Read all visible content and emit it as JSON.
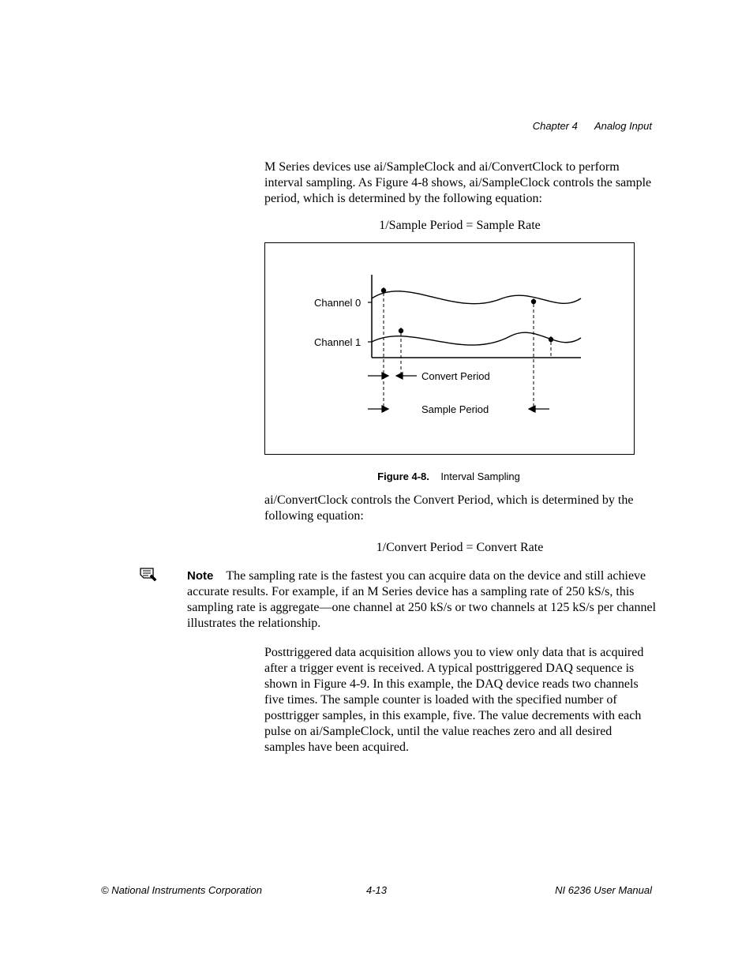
{
  "header": {
    "chapter": "Chapter 4",
    "title": "Analog Input"
  },
  "paragraphs": {
    "p1": "M Series devices use ai/SampleClock and ai/ConvertClock to perform interval sampling. As Figure 4-8 shows, ai/SampleClock controls the sample period, which is determined by the following equation:",
    "eq1": "1/Sample Period = Sample Rate",
    "p2": "ai/ConvertClock controls the Convert Period, which is determined by the following equation:",
    "eq2": "1/Convert Period = Convert Rate",
    "p3": "Posttriggered data acquisition allows you to view only data that is acquired after a trigger event is received. A typical posttriggered DAQ sequence is shown in Figure 4-9. In this example, the DAQ device reads two channels five times. The sample counter is loaded with the specified number of posttrigger samples, in this example, five. The value decrements with each pulse on ai/SampleClock, until the value reaches zero and all desired samples have been acquired."
  },
  "note": {
    "label": "Note",
    "text": "The sampling rate is the fastest you can acquire data on the device and still achieve accurate results. For example, if an M Series device has a sampling rate of 250 kS/s, this sampling rate is aggregate—one channel at 250 kS/s or two channels at 125 kS/s per channel illustrates the relationship."
  },
  "figure": {
    "number": "Figure 4-8.",
    "title": "Interval Sampling",
    "labels": {
      "ch0": "Channel 0",
      "ch1": "Channel 1",
      "convert": "Convert Period",
      "sample": "Sample Period"
    }
  },
  "footer": {
    "left": "© National Instruments Corporation",
    "center": "4-13",
    "right": "NI 6236 User Manual"
  }
}
